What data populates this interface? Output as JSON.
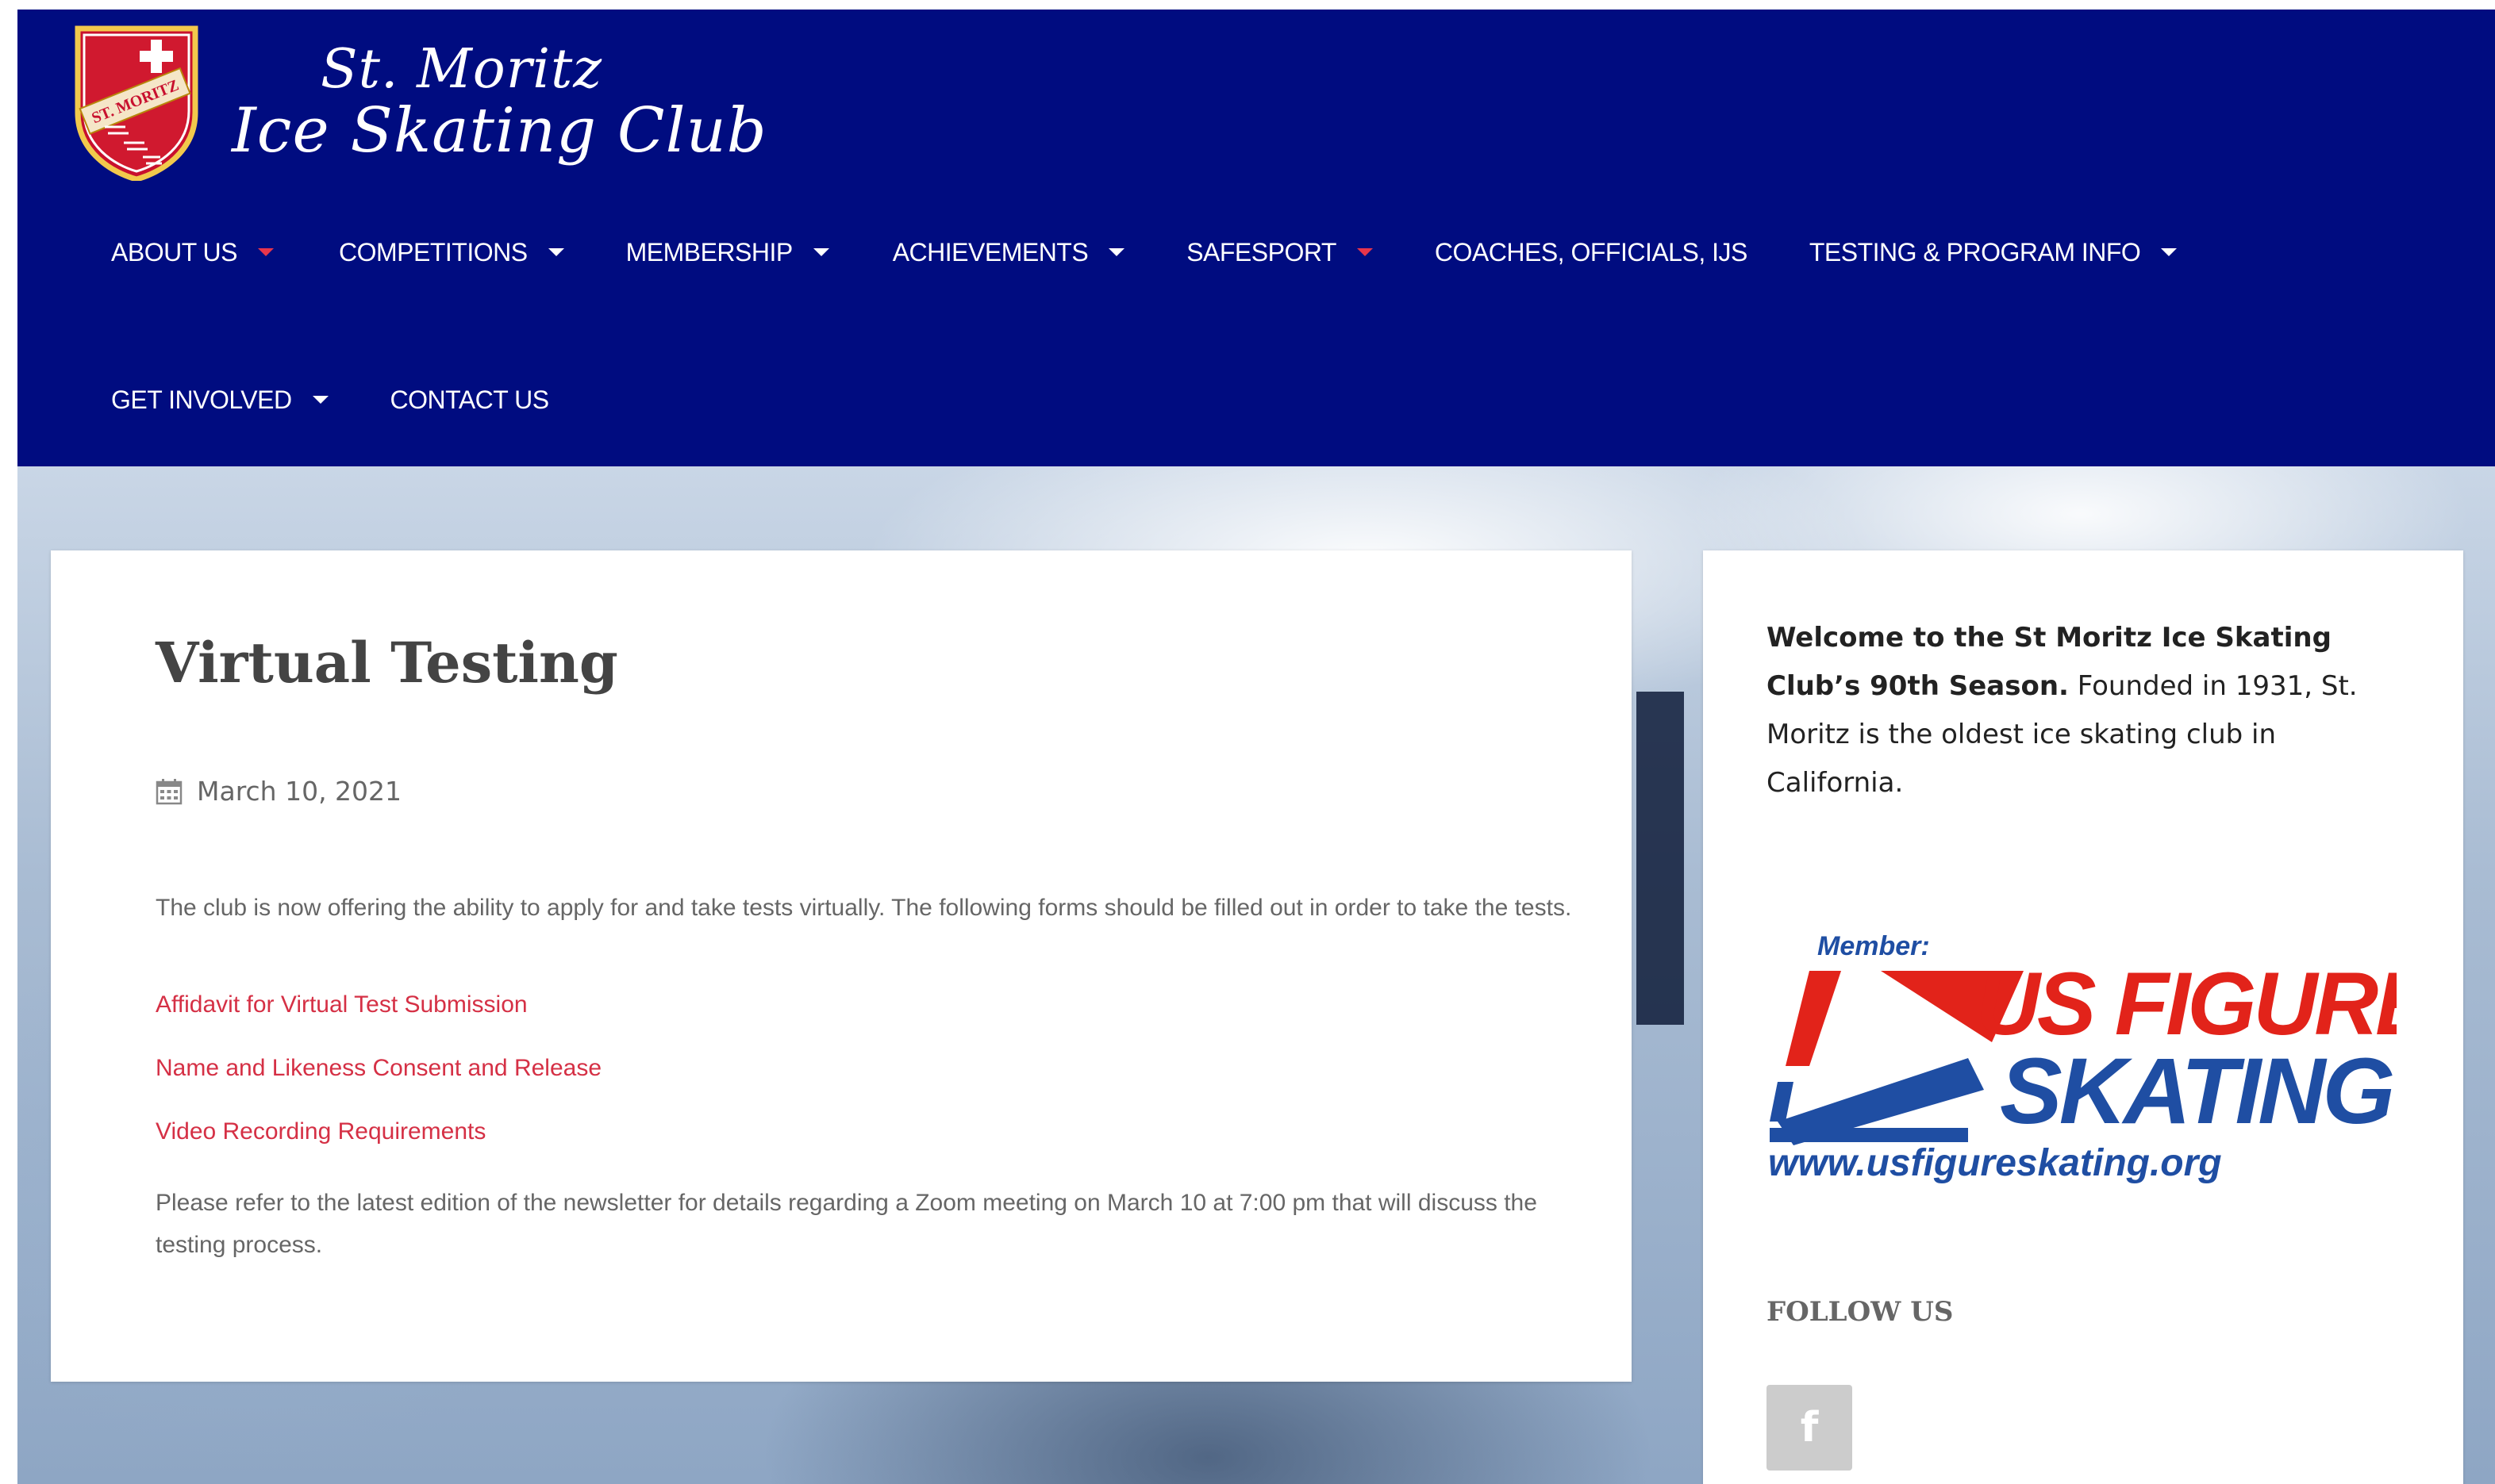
{
  "site": {
    "title_line1": "St. Moritz",
    "title_line2": "Ice Skating Club",
    "crest_text": "ST. MORITZ",
    "header_color": "#000c80",
    "accent_color": "#d53045"
  },
  "nav": {
    "row1": [
      {
        "label": "ABOUT US",
        "has_dropdown": true,
        "caret_color": "#e8354b"
      },
      {
        "label": "COMPETITIONS",
        "has_dropdown": true
      },
      {
        "label": "MEMBERSHIP",
        "has_dropdown": true
      },
      {
        "label": "ACHIEVEMENTS",
        "has_dropdown": true
      },
      {
        "label": "SAFESPORT",
        "has_dropdown": true,
        "caret_color": "#e8354b"
      },
      {
        "label": "COACHES, OFFICIALS, IJS",
        "has_dropdown": false
      },
      {
        "label": "TESTING & PROGRAM INFO",
        "has_dropdown": true
      }
    ],
    "row2": [
      {
        "label": "GET INVOLVED",
        "has_dropdown": true
      },
      {
        "label": "CONTACT US",
        "has_dropdown": false
      }
    ]
  },
  "post": {
    "title": "Virtual Testing",
    "date": "March 10, 2021",
    "date_icon": "calendar-icon",
    "intro": "The club is now offering the ability to apply for and take tests virtually.  The following forms should be filled out in order to take the tests.",
    "links": [
      "Affidavit for Virtual Test Submission",
      "Name and Likeness Consent and Release",
      "Video Recording Requirements"
    ],
    "closing": "Please refer to the latest edition of the newsletter for details regarding a Zoom meeting on March 10 at 7:00 pm that will discuss the testing process."
  },
  "sidebar": {
    "welcome_bold": "Welcome to the St Moritz Ice Skating Club’s 90th Season.",
    "welcome_rest": " Founded in 1931, St. Moritz is the oldest ice skating club in California.",
    "usfs": {
      "member_label": "Member:",
      "line1": "US FIGURE",
      "line2": "SKATING",
      "url": "www.usfigureskating.org"
    },
    "follow_title": "FOLLOW US",
    "social": [
      {
        "icon": "facebook-icon",
        "glyph": "f"
      }
    ]
  }
}
